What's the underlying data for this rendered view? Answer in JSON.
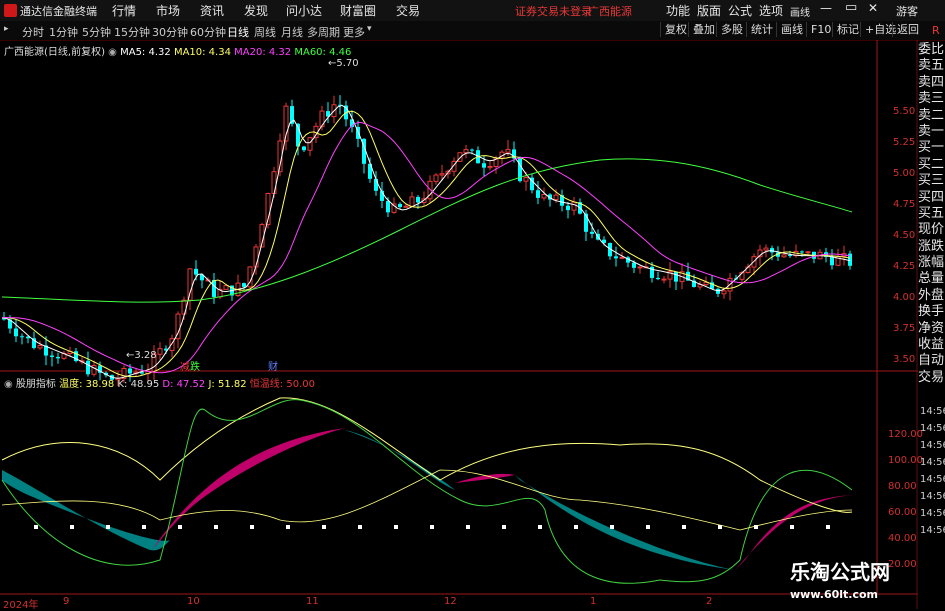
{
  "app": {
    "title": "通达信金融终端",
    "notice": "证券交易未登录",
    "stock": "广西能源"
  },
  "menu": [
    "行情",
    "市场",
    "资讯",
    "发现",
    "问小达",
    "财富圈",
    "交易"
  ],
  "right_menu": [
    "功能",
    "版面",
    "公式",
    "选项",
    "画线",
    "游客"
  ],
  "timeframes": [
    "分时",
    "1分钟",
    "5分钟",
    "15分钟",
    "30分钟",
    "60分钟",
    "日线",
    "周线",
    "月线",
    "多周期",
    "更多"
  ],
  "active_timeframe": "日线",
  "toolbar_buttons": [
    "复权",
    "叠加",
    "多股",
    "统计",
    "画线",
    "F10",
    "标记",
    "+自选",
    "返回"
  ],
  "legend": {
    "name": "广西能源(日线,前复权)",
    "ma5": "MA5: 4.32",
    "ma10": "MA10: 4.34",
    "ma20": "MA20: 4.32",
    "ma60": "MA60: 4.46"
  },
  "price_marks": {
    "high": "5.70",
    "low": "3.28"
  },
  "event_marks": [
    "减",
    "跌",
    "财"
  ],
  "indicator": {
    "name": "股朋指标",
    "wendu": "温度: 38.98",
    "k": "K: 48.95",
    "d": "D: 47.52",
    "j": "J: 51.82",
    "hengwen": "恒温线: 50.00"
  },
  "y_axis": [
    "5.50",
    "5.25",
    "5.00",
    "4.75",
    "4.50",
    "4.25",
    "4.00",
    "3.75",
    "3.50"
  ],
  "y_axis2": [
    "120.00",
    "100.00",
    "80.00",
    "60.00",
    "40.00",
    "20.00"
  ],
  "sidebar": [
    "委比",
    "卖五",
    "卖四",
    "卖三",
    "卖二",
    "卖一",
    "买一",
    "买二",
    "买三",
    "买四",
    "买五",
    "现价",
    "涨跌",
    "涨幅",
    "总量",
    "外盘",
    "换手",
    "净资",
    "收益",
    "自动",
    "交易"
  ],
  "times": [
    "14:56",
    "14:56",
    "14:56",
    "14:56",
    "14:56",
    "14:56",
    "14:56",
    "14:56"
  ],
  "x_axis": [
    "2024年",
    "9",
    "10",
    "11",
    "12",
    "1",
    "2"
  ],
  "watermark": {
    "cn": "乐淘公式网",
    "url": "www.60lt.com"
  },
  "colors": {
    "up": "#e83838",
    "down": "#00ffff",
    "ma5": "#ffffff",
    "ma10": "#ffff60",
    "ma20": "#ff40ff",
    "ma60": "#40ff40",
    "teal": "#008080",
    "magenta": "#c0006a"
  }
}
